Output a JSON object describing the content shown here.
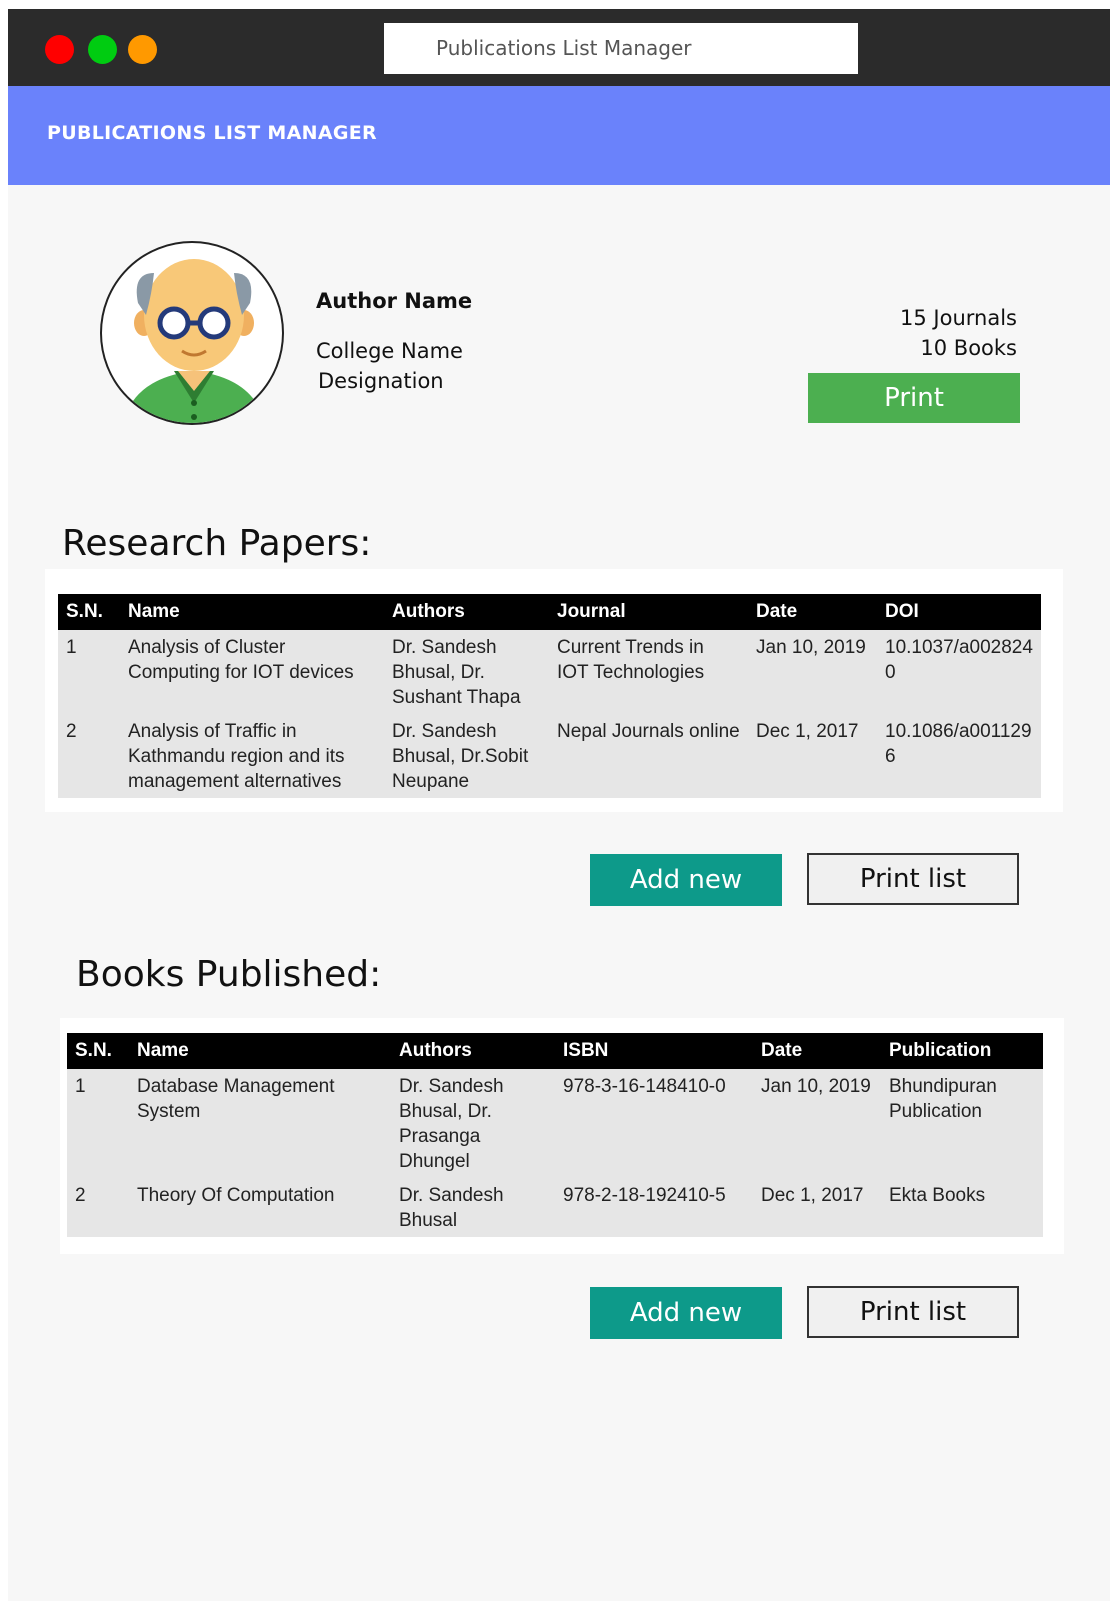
{
  "window": {
    "url_text": "Publications List Manager"
  },
  "app": {
    "title": "PUBLICATIONS LIST MANAGER"
  },
  "profile": {
    "author_name": "Author Name",
    "college": "College Name",
    "designation": "Designation",
    "journals_count": "15 Journals",
    "books_count": "10 Books",
    "print_label": "Print"
  },
  "research": {
    "heading": "Research Papers:",
    "columns": [
      "S.N.",
      "Name",
      "Authors",
      "Journal",
      "Date",
      "DOI"
    ],
    "rows": [
      [
        "1",
        "Analysis of Cluster Computing for IOT devices",
        "Dr. Sandesh Bhusal, Dr. Sushant Thapa",
        "Current Trends in IOT Technologies",
        "Jan 10, 2019",
        "10.1037/a0028240"
      ],
      [
        "2",
        "Analysis of Traffic in Kathmandu region and its management alternatives",
        "Dr. Sandesh Bhusal, Dr.Sobit Neupane",
        "Nepal Journals online",
        "Dec 1, 2017",
        "10.1086/a0011296"
      ]
    ],
    "add_label": "Add new",
    "print_label": "Print list"
  },
  "books": {
    "heading": "Books Published:",
    "columns": [
      "S.N.",
      "Name",
      "Authors",
      "ISBN",
      "Date",
      "Publication"
    ],
    "rows": [
      [
        "1",
        "Database Management System",
        "Dr. Sandesh Bhusal, Dr. Prasanga Dhungel",
        "978-3-16-148410-0",
        "Jan 10, 2019",
        "Bhundipuran Publication"
      ],
      [
        "2",
        "Theory Of Computation",
        "Dr. Sandesh Bhusal",
        "978-2-18-192410-5",
        "Dec 1, 2017",
        "Ekta Books"
      ]
    ],
    "add_label": "Add new",
    "print_label": "Print list"
  },
  "colors": {
    "title_bar": "#2b2b2b",
    "app_bar": "#6a82fb",
    "print_button": "#4caf50",
    "add_button": "#0d9a8a"
  }
}
